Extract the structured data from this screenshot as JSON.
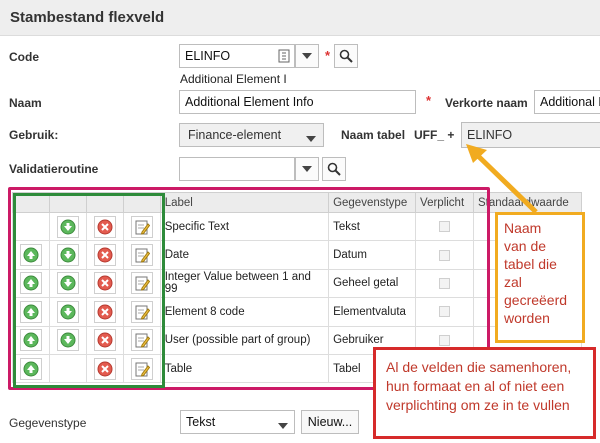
{
  "header": {
    "title": "Stambestand flexveld"
  },
  "form": {
    "code": {
      "label": "Code",
      "value": "ELINFO",
      "description": "Additional Element I"
    },
    "naam": {
      "label": "Naam",
      "value": "Additional Element Info"
    },
    "verkorte_naam": {
      "label": "Verkorte naam",
      "value": "Additional E"
    },
    "gebruik": {
      "label": "Gebruik:",
      "value": "Finance-element"
    },
    "naam_tabel": {
      "label": "Naam tabel",
      "prefix": "UFF_ +",
      "value": "ELINFO"
    },
    "validatieroutine": {
      "label": "Validatieroutine",
      "value": ""
    },
    "required_marker": "*"
  },
  "grid": {
    "columns": [
      "Label",
      "Gegevenstype",
      "Verplicht",
      "Standaardwaarde"
    ],
    "rows": [
      {
        "label": "Specific Text",
        "type": "Tekst",
        "up": false
      },
      {
        "label": "Date",
        "type": "Datum",
        "up": true
      },
      {
        "label": "Integer Value between 1 and 99",
        "type": "Geheel getal",
        "up": true
      },
      {
        "label": "Element 8 code",
        "type": "Elementvaluta",
        "up": true
      },
      {
        "label": "User (possible part of group)",
        "type": "Gebruiker",
        "up": true
      },
      {
        "label": "Table",
        "type": "Tabel",
        "up": true,
        "down": false
      }
    ]
  },
  "footer": {
    "gegevenstype": {
      "label": "Gegevenstype",
      "value": "Tekst"
    },
    "new_button": "Nieuw..."
  },
  "callouts": {
    "table_name": "Naam\nvan de\ntabel die\nzal\ngecreëerd\nworden",
    "fields": "Al de velden die samenhoren,\nhun formaat en al of niet een\nverplichting om ze in te vullen"
  },
  "colors": {
    "arrow": "#f1ab20",
    "pink_outline": "#cc1a66",
    "green_outline": "#2e8b3a",
    "callout_red": "#d62a2a",
    "callout_text": "#c0392b"
  },
  "icons": [
    "search-icon",
    "chevron-down-icon",
    "lookup-list-icon",
    "move-up-icon",
    "move-down-icon",
    "delete-icon",
    "edit-icon"
  ]
}
